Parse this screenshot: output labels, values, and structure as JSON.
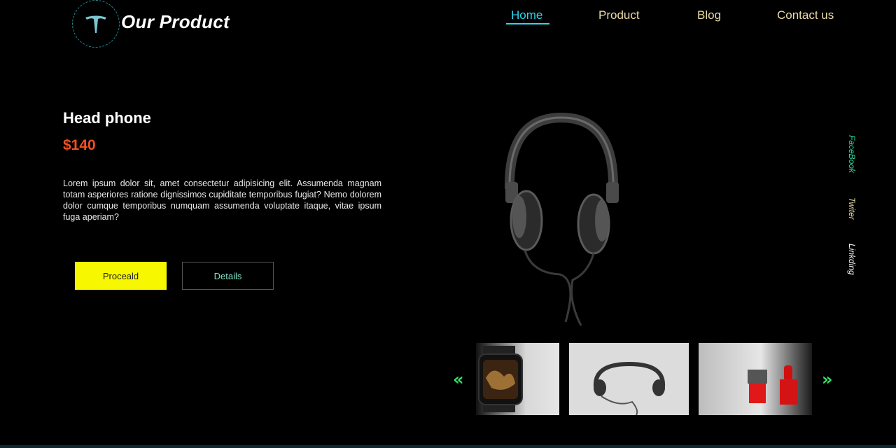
{
  "header": {
    "brand": "Our Product",
    "nav": [
      {
        "label": "Home",
        "active": true
      },
      {
        "label": "Product",
        "active": false
      },
      {
        "label": "Blog",
        "active": false
      },
      {
        "label": "Contact us",
        "active": false
      }
    ]
  },
  "product": {
    "title": "Head phone",
    "price": "$140",
    "description": "Lorem ipsum dolor sit, amet consectetur adipisicing elit. Assumenda magnam totam asperiores ratione dignissimos cupiditate temporibus fugiat? Nemo dolorem dolor cumque temporibus numquam assumenda voluptate itaque, vitae ipsum fuga aperiam?",
    "proceed_label": "Proceald",
    "details_label": "Details"
  },
  "social": {
    "facebook": "FaceBook",
    "twitter": "Twiter",
    "linkedin": "Linkding"
  },
  "carousel": {
    "prev_icon": "«",
    "next_icon": "»",
    "thumbs": [
      {
        "icon": "smartwatch-icon"
      },
      {
        "icon": "headphones-icon"
      },
      {
        "icon": "lipstick-icon"
      }
    ]
  },
  "colors": {
    "accent_cyan": "#2ad6f0",
    "nav_text": "#e9dca8",
    "price": "#f05022",
    "proceed_bg": "#f7f700",
    "arrow": "#2ee86a"
  }
}
